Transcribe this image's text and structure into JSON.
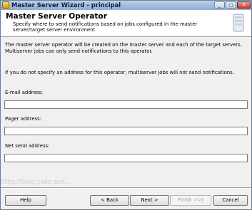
{
  "window": {
    "title": "Master Server Wizard - principal",
    "controls": {
      "minimize": "_",
      "maximize": "□",
      "close": "✕"
    }
  },
  "header": {
    "title": "Master Server Operator",
    "subtitle": "Specify where to send notifications based on jobs configured in the master server/target server environment."
  },
  "body": {
    "paragraph1": "The master server operator will be created on the master server and each of the target servers. Multiserver jobs can only send notifications to this operator.",
    "paragraph2": "If you do not specify an address for this operator, multiserver jobs will not send notifications."
  },
  "fields": {
    "email": {
      "label": "E-mail address:",
      "value": ""
    },
    "pager": {
      "label": "Pager address:",
      "value": ""
    },
    "net_send": {
      "label": "Net send address:",
      "value": ""
    }
  },
  "buttons": {
    "help": "Help",
    "back": "< Back",
    "next": "Next >",
    "finish": "Finish >>|",
    "cancel": "Cancel"
  },
  "watermark": "http://blog.csdn.net/..."
}
